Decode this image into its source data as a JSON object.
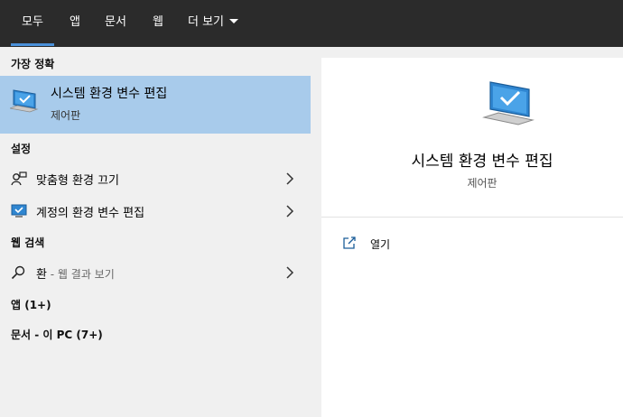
{
  "tabs": [
    {
      "label": "모두",
      "active": true
    },
    {
      "label": "앱",
      "active": false
    },
    {
      "label": "문서",
      "active": false
    },
    {
      "label": "웹",
      "active": false
    },
    {
      "label": "더 보기",
      "active": false
    }
  ],
  "sections": {
    "best_match": "가장 정확",
    "settings": "설정",
    "web_search": "웹 검색",
    "apps": "앱 (1+)",
    "docs": "문서 - 이 PC (7+)"
  },
  "best_match": {
    "title": "시스템 환경 변수 편집",
    "subtitle": "제어판",
    "icon": "monitor-check-icon"
  },
  "settings_items": [
    {
      "label": "맞춤형 환경 끄기",
      "icon": "person-feedback-icon"
    },
    {
      "label": "계정의 환경 변수 편집",
      "icon": "monitor-icon"
    }
  ],
  "web_item": {
    "query": "환",
    "suffix": " - 웹 결과 보기",
    "icon": "search-icon"
  },
  "preview": {
    "title": "시스템 환경 변수 편집",
    "subtitle": "제어판",
    "action_label": "열기",
    "icon": "monitor-check-icon"
  },
  "colors": {
    "topbar": "#2b2b2b",
    "accent": "#4a90d9",
    "selected_bg": "#a8cbeb",
    "pane_bg": "#f0f0f0"
  }
}
